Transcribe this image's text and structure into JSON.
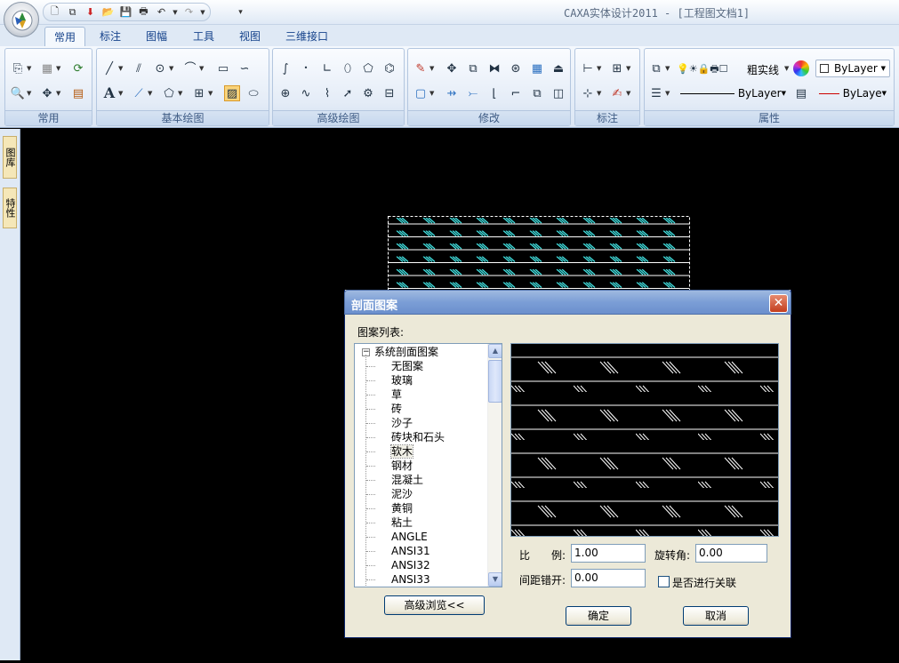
{
  "app": {
    "title": "CAXA实体设计2011 - [工程图文档1]",
    "qat_icons": [
      "new-icon",
      "new-window-icon",
      "import-icon",
      "open-icon",
      "save-icon",
      "print-icon",
      "undo-icon",
      "redo-icon"
    ]
  },
  "tabs": [
    {
      "label": "常用",
      "active": true
    },
    {
      "label": "标注"
    },
    {
      "label": "图幅"
    },
    {
      "label": "工具"
    },
    {
      "label": "视图"
    },
    {
      "label": "三维接口"
    }
  ],
  "groups": {
    "common": "常用",
    "basic_draw": "基本绘图",
    "advanced_draw": "高级绘图",
    "modify": "修改",
    "annotate": "标注",
    "properties": "属性"
  },
  "properties": {
    "line_type": "粗实线",
    "color_value": "ByLayer",
    "linestyle_value": "ByLayer",
    "lineweight_value": "ByLaye"
  },
  "sidebar": {
    "tab1": "图库",
    "tab2": "特性"
  },
  "dialog": {
    "title": "剖面图案",
    "list_label": "图案列表:",
    "tree_root": "系统剖面图案",
    "tree_items": [
      "无图案",
      "玻璃",
      "草",
      "砖",
      "沙子",
      "砖块和石头",
      "软木",
      "钢材",
      "混凝土",
      "泥沙",
      "黄铜",
      "粘土",
      "ANGLE",
      "ANSI31",
      "ANSI32",
      "ANSI33"
    ],
    "selected_item": "软木",
    "scale_label": "比　　例:",
    "scale_value": "1.00",
    "rotation_label": "旋转角:",
    "rotation_value": "0.00",
    "offset_label": "间距错开:",
    "offset_value": "0.00",
    "associate_label": "是否进行关联",
    "advanced_button": "高级浏览<<",
    "ok_button": "确定",
    "cancel_button": "取消"
  },
  "colors": {
    "canvas": "#000000",
    "hatch_cyan": "#40e0e0",
    "ribbon_bg": "#dfe9f5",
    "dialog_bg": "#ece9d8",
    "title_blue": "#7b9ed6"
  }
}
